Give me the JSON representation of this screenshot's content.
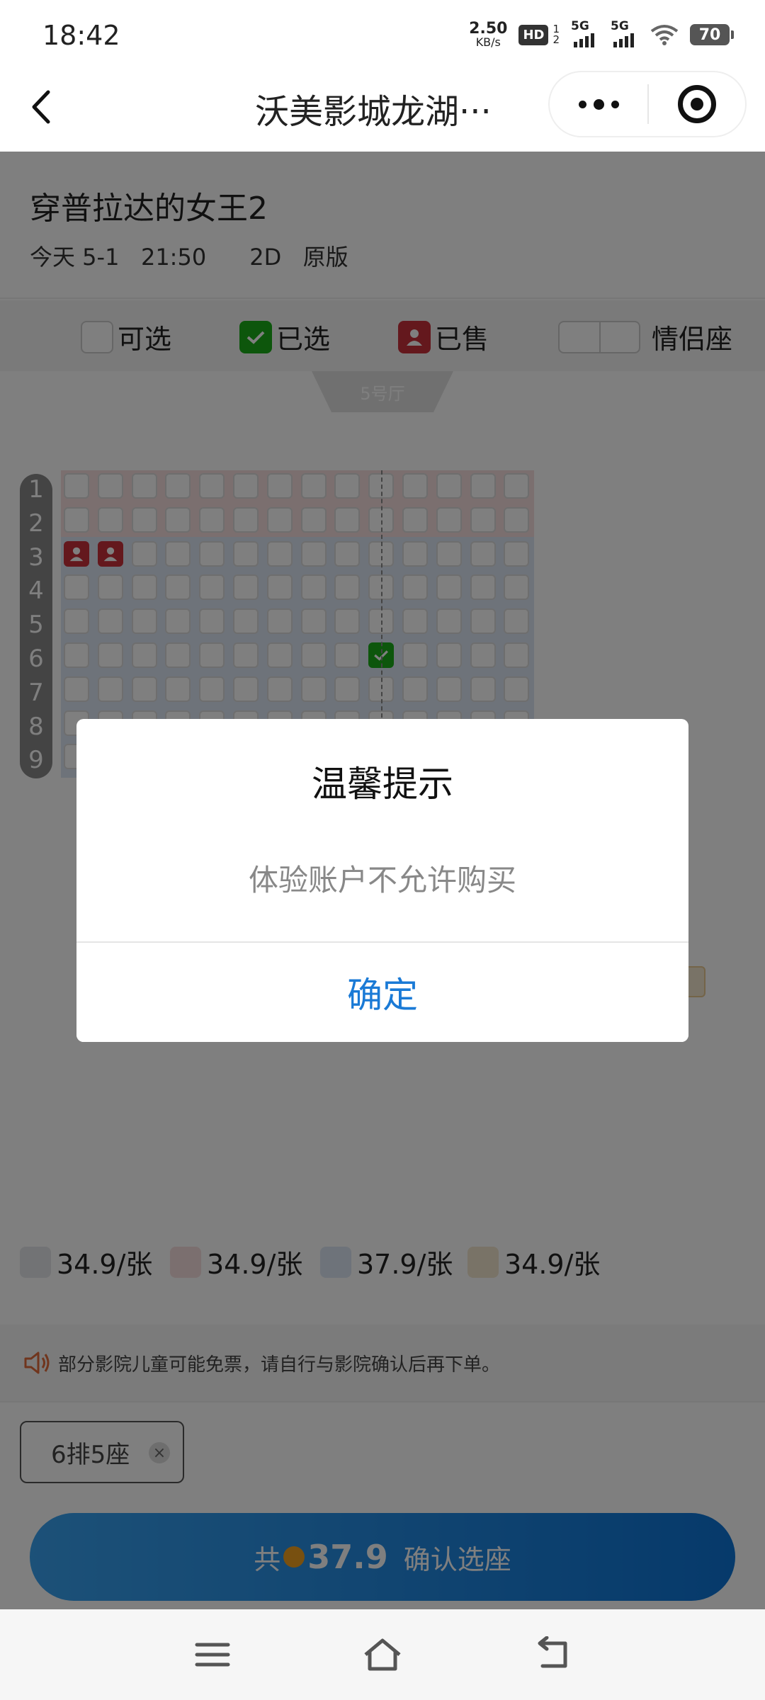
{
  "status_bar": {
    "time": "18:42",
    "net_speed": "2.50",
    "net_unit": "KB/s",
    "hd_label": "HD",
    "hd_sim_top": "1",
    "hd_sim_bottom": "2",
    "signal1_label": "5G",
    "signal2_label": "5G",
    "battery": "70",
    "icons": [
      "hd-voice-icon",
      "signal-icon",
      "wifi-icon",
      "battery-icon"
    ]
  },
  "nav": {
    "title": "沃美影城龙湖···",
    "icons": [
      "back-icon",
      "more-icon",
      "target-icon"
    ]
  },
  "movie": {
    "title": "穿普拉达的女王2",
    "meta": "今天 5-1   21:50      2D   原版"
  },
  "legend": {
    "available": "可选",
    "selected": "已选",
    "sold": "已售",
    "couple": "情侣座"
  },
  "hall": {
    "name": "5号厅",
    "rows": [
      "1",
      "2",
      "3",
      "4",
      "5",
      "6",
      "7",
      "8",
      "9"
    ],
    "columns": 14,
    "sold_seats": [
      [
        3,
        1
      ],
      [
        3,
        2
      ]
    ],
    "selected_seats": [
      [
        6,
        10
      ]
    ],
    "zone_colors": {
      "red_zone": "#f6dede",
      "blue_zone": "#dce6f4",
      "gold_zone": "#f2e6cf"
    }
  },
  "prices": [
    {
      "label": "34.9/张",
      "color": "#e4e6ea"
    },
    {
      "label": "34.9/张",
      "color": "#f6dede"
    },
    {
      "label": "37.9/张",
      "color": "#dce6f4"
    },
    {
      "label": "34.9/张",
      "color": "#f2e6cf"
    }
  ],
  "notice": {
    "text": "部分影院儿童可能免票，请自行与影院确认后再下单。",
    "icon": "speaker-icon"
  },
  "picked": {
    "seat": "6排5座",
    "close": "×"
  },
  "confirm": {
    "prefix": "共",
    "price": "37.9",
    "label": "确认选座"
  },
  "dialog": {
    "title": "温馨提示",
    "message": "体验账户不允许购买",
    "ok": "确定"
  },
  "sys_nav": {
    "icons": [
      "menu-icon",
      "home-icon",
      "back-nav-icon"
    ]
  },
  "colors": {
    "accent_blue": "#1a7ad6",
    "selected_green": "#1aad19",
    "sold_red": "#c9303a"
  }
}
